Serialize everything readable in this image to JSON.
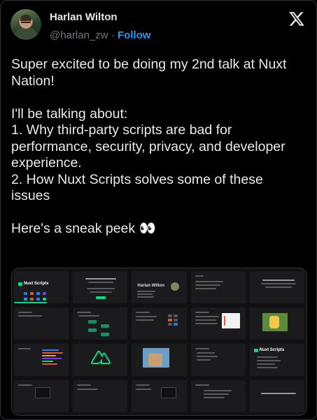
{
  "author": {
    "name": "Harlan Wilton",
    "handle": "@harlan_zw",
    "separator": "·",
    "follow_label": "Follow"
  },
  "icons": {
    "brand": "x-logo-icon",
    "avatar": "avatar-photo"
  },
  "tweet": {
    "text": "Super excited to be doing my 2nd talk at Nuxt Nation!\n\nI'll be talking about:\n1. Why third-party scripts are bad for performance, security, privacy, and developer experience.\n2. How Nuxt Scripts solves some of these issues\n\nHere's a sneak peek 👀"
  },
  "media": {
    "slides": [
      {
        "title": "Nuxt Scripts"
      },
      {
        "title": ""
      },
      {
        "title": "Harlan Wilton"
      },
      {
        "title": ""
      },
      {
        "title": ""
      },
      {
        "title": ""
      },
      {
        "title": ""
      },
      {
        "title": ""
      },
      {
        "title": ""
      },
      {
        "title": ""
      },
      {
        "title": ""
      },
      {
        "title": ""
      },
      {
        "title": ""
      },
      {
        "title": ""
      },
      {
        "title": "Nuxt Scripts"
      },
      {
        "title": ""
      },
      {
        "title": ""
      },
      {
        "title": ""
      },
      {
        "title": ""
      },
      {
        "title": ""
      }
    ]
  },
  "colors": {
    "accent": "#1d9bf0",
    "nuxt_green": "#00dc82",
    "text": "#e7e9ea",
    "muted": "#71767b"
  }
}
